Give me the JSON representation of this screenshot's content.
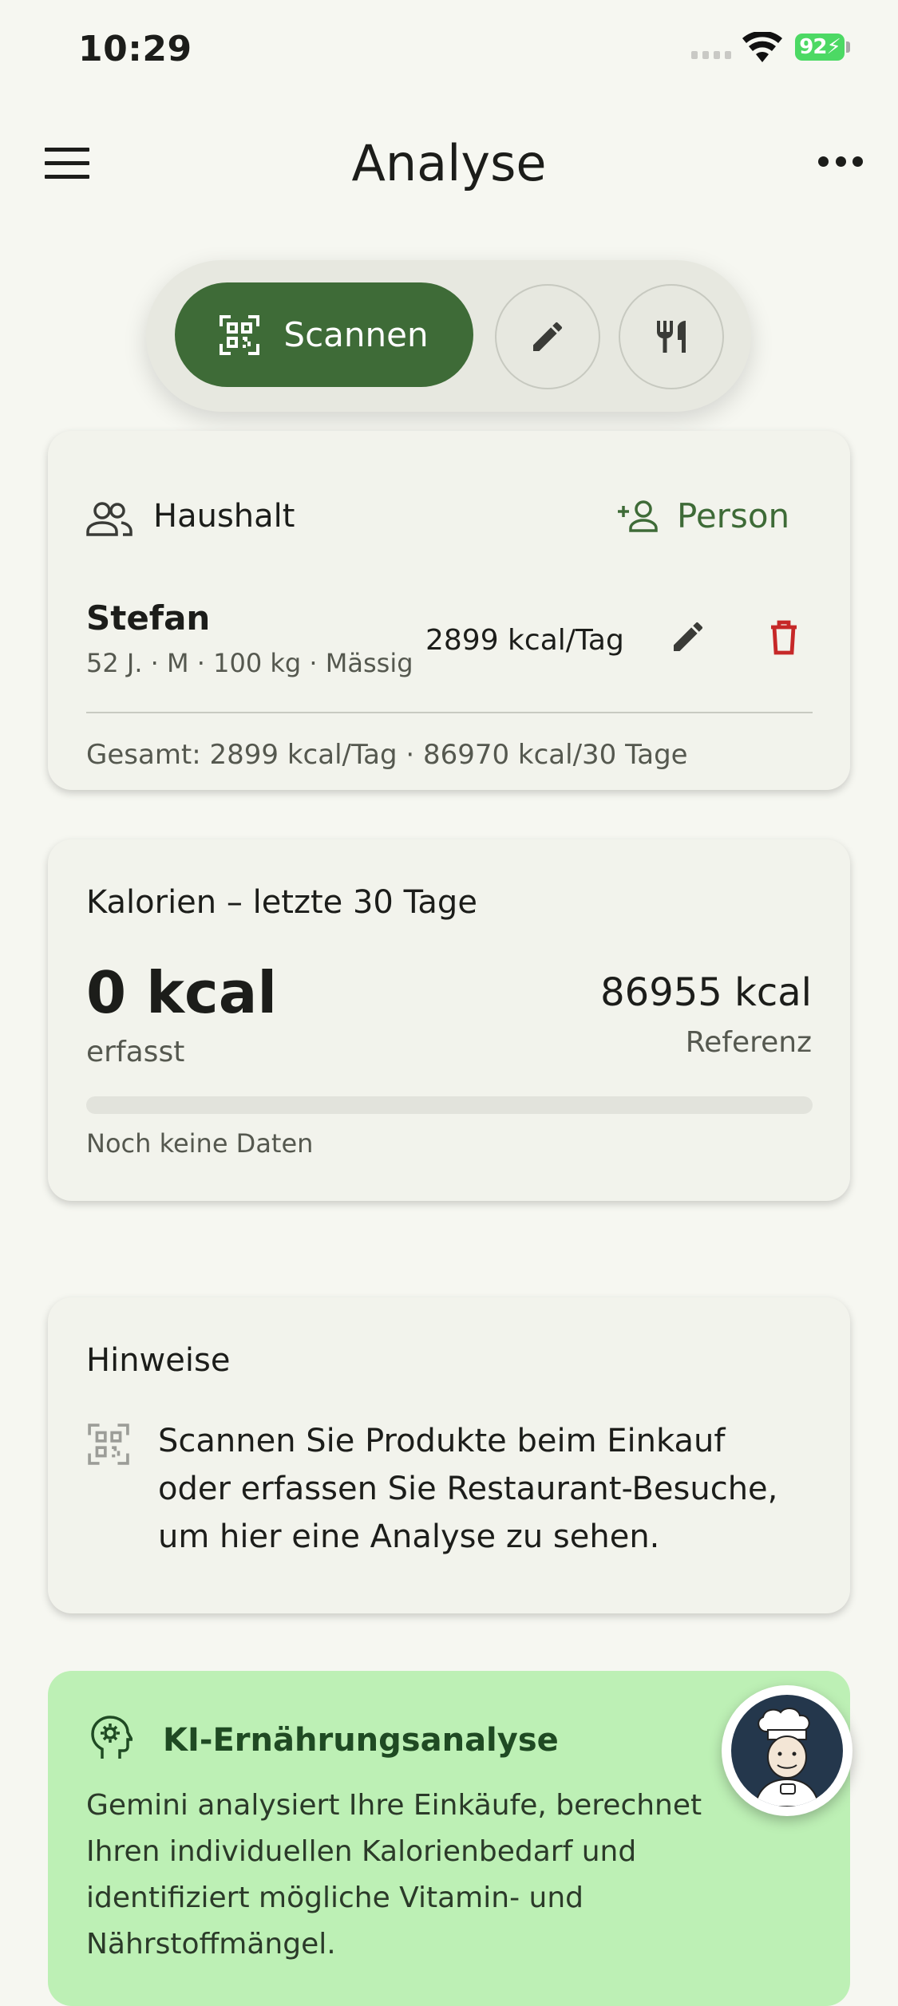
{
  "status_bar": {
    "time": "10:29",
    "battery": "92"
  },
  "app_bar": {
    "title": "Analyse",
    "menu_icon": "hamburger-menu-icon",
    "more_icon": "more-horizontal-icon"
  },
  "actions": {
    "scan_label": "Scannen",
    "scan_icon": "qr-scan-icon",
    "edit_icon": "pencil-icon",
    "restaurant_icon": "fork-knife-icon"
  },
  "household": {
    "title": "Haushalt",
    "add_person_label": "Person",
    "person": {
      "name": "Stefan",
      "details": "52 J. · M · 100 kg · Mässig",
      "kcal": "2899 kcal/Tag"
    },
    "total": "Gesamt: 2899 kcal/Tag · 86970 kcal/30 Tage"
  },
  "calories": {
    "title": "Kalorien – letzte 30 Tage",
    "recorded_value": "0 kcal",
    "recorded_label": "erfasst",
    "reference_value": "86955 kcal",
    "reference_label": "Referenz",
    "progress": 0,
    "status": "Noch keine Daten"
  },
  "hints": {
    "title": "Hinweise",
    "text_lines": [
      "Scannen Sie Produkte beim Einkauf",
      "oder erfassen Sie Restaurant-Besuche,",
      "um hier eine Analyse zu sehen."
    ]
  },
  "ai": {
    "title": "KI-Ernährungsanalyse",
    "text_lines": [
      "Gemini analysiert Ihre Einkäufe, berechnet",
      "Ihren individuellen Kalorienbedarf und",
      "identifiziert mögliche Vitamin- und",
      "Nährstoffmängel."
    ]
  },
  "colors": {
    "primary": "#3e6b37",
    "danger": "#c62828",
    "ai_card_bg": "#bdf0b5",
    "background": "#f6f7f1"
  }
}
